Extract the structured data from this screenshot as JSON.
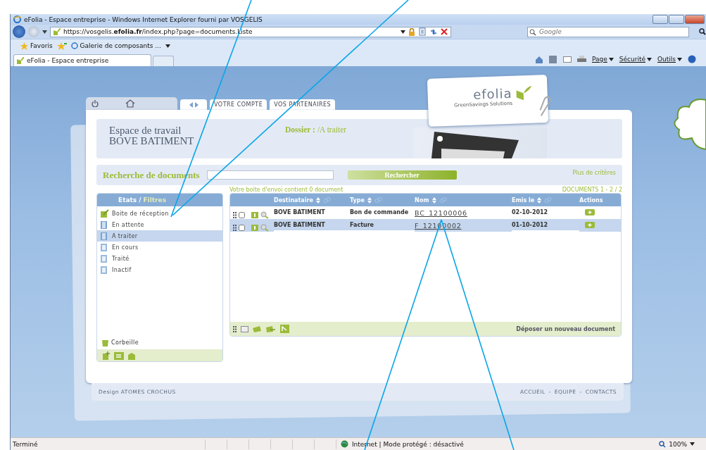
{
  "browser": {
    "title": "eFolia - Espace entreprise - Windows Internet Explorer fourni par VOSGELIS",
    "url_parts": [
      "https://vosgelis.",
      "efolia.fr",
      "/index.php?page=documents.Liste"
    ],
    "search_placeholder": "Google",
    "favorites": "Favoris",
    "favorite_links": [
      "Galerie de composants ..."
    ],
    "tabs": [
      {
        "label": "eFolia - Espace entreprise",
        "selected": true
      }
    ],
    "command_menus": [
      "Page",
      "Sécurité",
      "Outils"
    ],
    "status": "Terminé",
    "zone": "Internet | Mode protégé : désactivé",
    "zoom": "100%"
  },
  "app": {
    "nav_tabs": [
      "VOTRE COMPTE",
      "VOS PARTENAIRES"
    ],
    "logo": "efolia",
    "logo_tagline": "GreenSavings Solutions",
    "workspace": {
      "title": "Espace de travail",
      "company": "BOVE BATIMENT",
      "folder_label": "Dossier :",
      "folder_path": "/A traiter"
    },
    "search": {
      "label": "Recherche de documents",
      "button": "Rechercher",
      "more": "Plus de critères"
    },
    "outbox_info": "Votre boite d'envoi contient 0 document",
    "count": "DOCUMENTS 1 - 2 / 2",
    "filters": {
      "title": "Etats",
      "title_accent": "Filtres",
      "separator": "/",
      "items": [
        {
          "label": "Boite de réception",
          "kind": "inbox",
          "selected": false
        },
        {
          "label": "En attente",
          "kind": "folder",
          "selected": false
        },
        {
          "label": "A traiter",
          "kind": "folder",
          "selected": true
        },
        {
          "label": "En cours",
          "kind": "status",
          "selected": false
        },
        {
          "label": "Traité",
          "kind": "status",
          "selected": false
        },
        {
          "label": "Inactif",
          "kind": "status",
          "selected": false
        }
      ],
      "trash": "Corbeille"
    },
    "table": {
      "columns": [
        {
          "label": "Destinataire",
          "sortable": true
        },
        {
          "label": "Type",
          "sortable": true
        },
        {
          "label": "Nom",
          "sortable": true
        },
        {
          "label": "Emis le",
          "sortable": true
        },
        {
          "label": "Actions",
          "sortable": false
        }
      ],
      "rows": [
        {
          "recipient": "BOVE BATIMENT",
          "type": "Bon de commande",
          "name": "BC_12100006",
          "date": "02-10-2012",
          "checked": false
        },
        {
          "recipient": "BOVE BATIMENT",
          "type": "Facture",
          "name": "F_12100002",
          "date": "01-10-2012",
          "checked": false
        }
      ],
      "upload": "Déposer un nouveau document"
    },
    "footer": {
      "credit": "Design ATOMES CROCHUS",
      "links": [
        "ACCUEIL",
        "EQUIPE",
        "CONTACTS"
      ],
      "separator": "-"
    }
  }
}
